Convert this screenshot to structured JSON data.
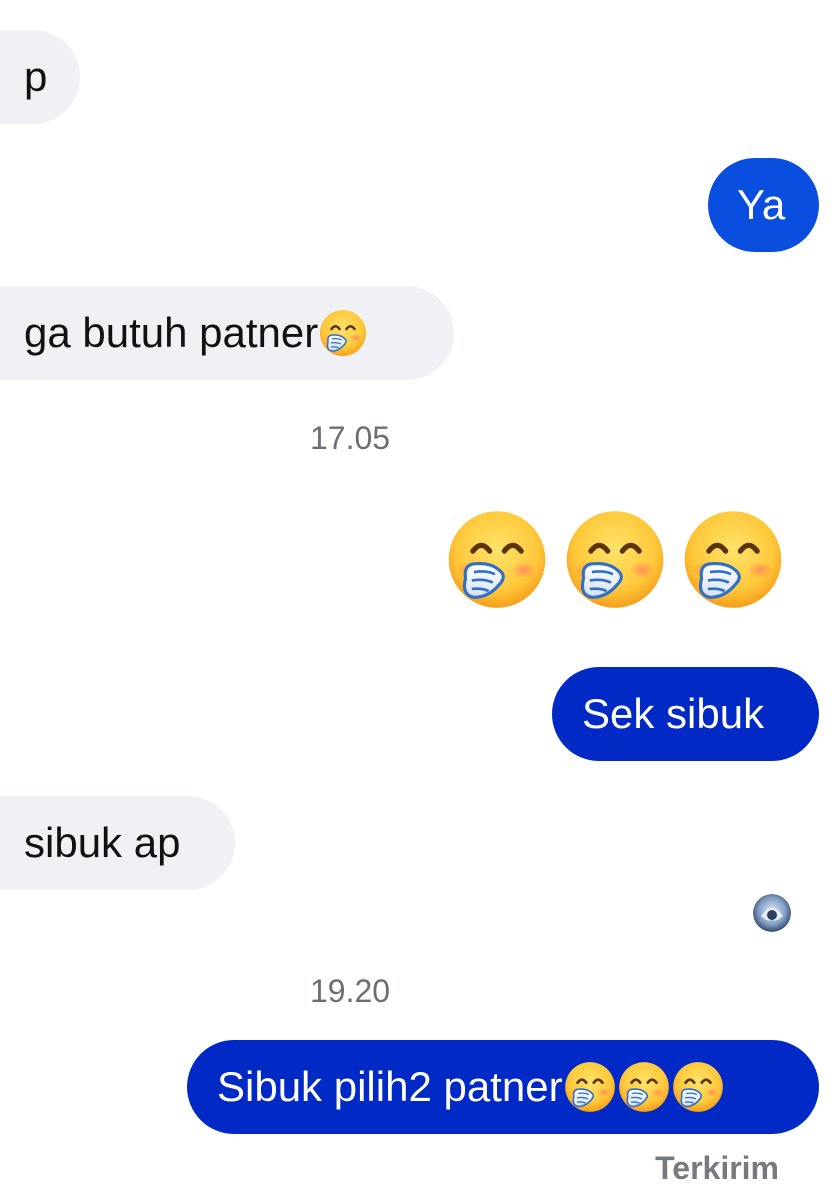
{
  "messages": {
    "m1": {
      "text": "p",
      "from": "other"
    },
    "m2": {
      "text": "Ya",
      "from": "me"
    },
    "m3": {
      "text": "ga butuh patner",
      "emoji": "hand-over-mouth-emoji",
      "from": "other"
    },
    "m4": {
      "emoji": [
        "hand-over-mouth-emoji",
        "hand-over-mouth-emoji",
        "hand-over-mouth-emoji"
      ],
      "from": "me"
    },
    "m5": {
      "text": "Sek sibuk",
      "from": "me"
    },
    "m6": {
      "text": "sibuk ap",
      "from": "other"
    },
    "m7": {
      "text": "Sibuk pilih2 patner",
      "emoji": [
        "hand-over-mouth-emoji",
        "hand-over-mouth-emoji",
        "hand-over-mouth-emoji"
      ],
      "from": "me"
    }
  },
  "timestamps": {
    "t1": "17.05",
    "t2": "19.20"
  },
  "status": {
    "label": "Terkirim"
  },
  "colors": {
    "incoming_bubble": "#f0f1f5",
    "outgoing_bubble_light": "#0a4ee0",
    "outgoing_bubble_dark": "#0029c6",
    "timestamp_text": "#6b6f75"
  }
}
